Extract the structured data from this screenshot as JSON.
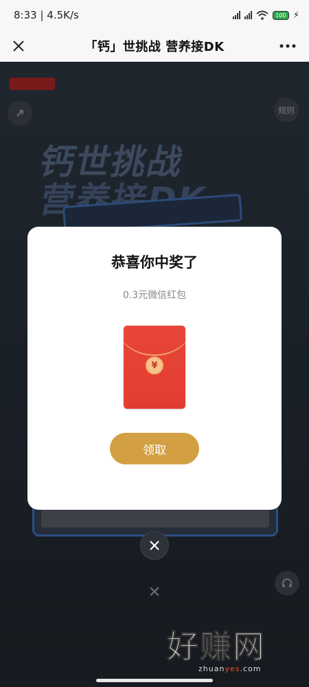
{
  "status_bar": {
    "time": "8:33",
    "speed": "4.5K/s",
    "battery": "100"
  },
  "header": {
    "title": "「钙」世挑战 营养接DK",
    "close_icon": "close-icon",
    "more_icon": "more-icon"
  },
  "background": {
    "rules_label": "规则",
    "tag_label": "",
    "headline_1": "钙世挑战",
    "headline_2": "营养接DK"
  },
  "modal": {
    "title": "恭喜你中奖了",
    "subtitle": "0.3元微信红包",
    "coin_symbol": "¥",
    "claim_label": "领取"
  },
  "watermark": {
    "main": "好赚网",
    "site_prefix": "zhuan",
    "site_highlight": "yes",
    "site_suffix": ".com"
  },
  "colors": {
    "accent": "#d2a043",
    "envelope": "#e23d30",
    "battery": "#2fa84f"
  }
}
